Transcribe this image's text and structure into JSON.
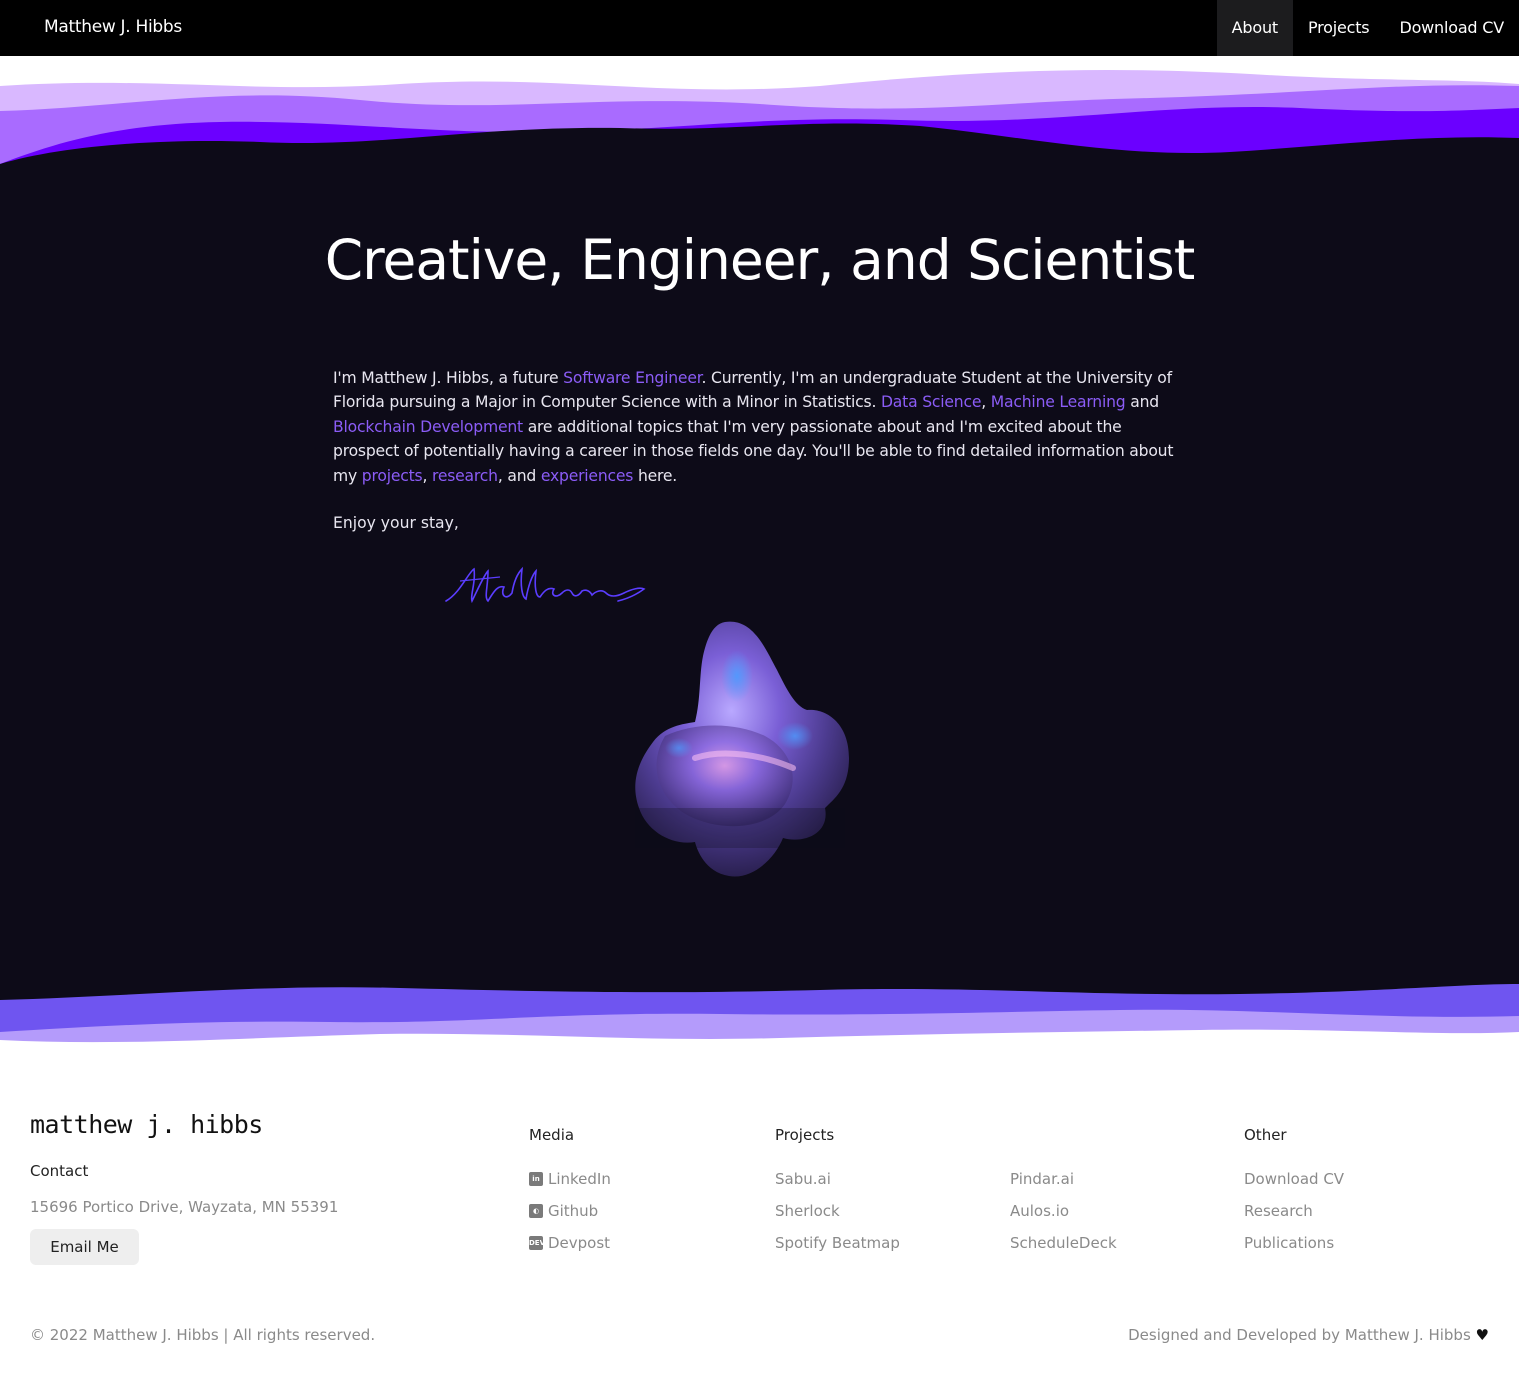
{
  "navbar": {
    "brand": "Matthew J. Hibbs",
    "links": [
      {
        "label": "About",
        "active": true
      },
      {
        "label": "Projects",
        "active": false
      },
      {
        "label": "Download CV",
        "active": false
      }
    ]
  },
  "hero": {
    "headline": "Creative, Engineer, and Scientist",
    "intro": {
      "t1": "I'm Matthew J. Hibbs, a future ",
      "l1": "Software Engineer",
      "t2": ". Currently, I'm an undergraduate Student at the University of Florida pursuing a Major in Computer Science with a Minor in Statistics. ",
      "l2": "Data Science",
      "t3": ", ",
      "l3": "Machine Learning",
      "t4": " and ",
      "l4": "Blockchain Development",
      "t5": " are additional topics that I'm very passionate about and I'm excited about the prospect of potentially having a career in those fields one day. You'll be able to find detailed information about my ",
      "l5": "projects",
      "t6": ", ",
      "l6": "research",
      "t7": ", and ",
      "l7": "experiences",
      "t8": " here."
    },
    "closing": "Enjoy your stay,",
    "signature": "Matthew"
  },
  "footer": {
    "logo": "matthew j. hibbs",
    "contact_heading": "Contact",
    "address": "15696 Portico Drive, Wayzata, MN 55391",
    "email_button": "Email Me",
    "media": {
      "heading": "Media",
      "links": [
        {
          "label": "LinkedIn",
          "icon": "linkedin-icon"
        },
        {
          "label": "Github",
          "icon": "github-icon"
        },
        {
          "label": "Devpost",
          "icon": "devpost-icon"
        }
      ]
    },
    "projects": {
      "heading": "Projects",
      "col1": [
        "Sabu.ai",
        "Sherlock",
        "Spotify Beatmap"
      ],
      "col2": [
        "Pindar.ai",
        "Aulos.io",
        "ScheduleDeck"
      ]
    },
    "other": {
      "heading": "Other",
      "links": [
        "Download CV",
        "Research",
        "Publications"
      ]
    },
    "copyright": "© 2022 Matthew J. Hibbs | All rights reserved.",
    "credit": "Designed and Developed by Matthew J. Hibbs",
    "heart": "♥"
  },
  "colors": {
    "accent": "#8b5cf6",
    "hero_bg": "#0d0b18",
    "nav_bg": "#000000"
  }
}
